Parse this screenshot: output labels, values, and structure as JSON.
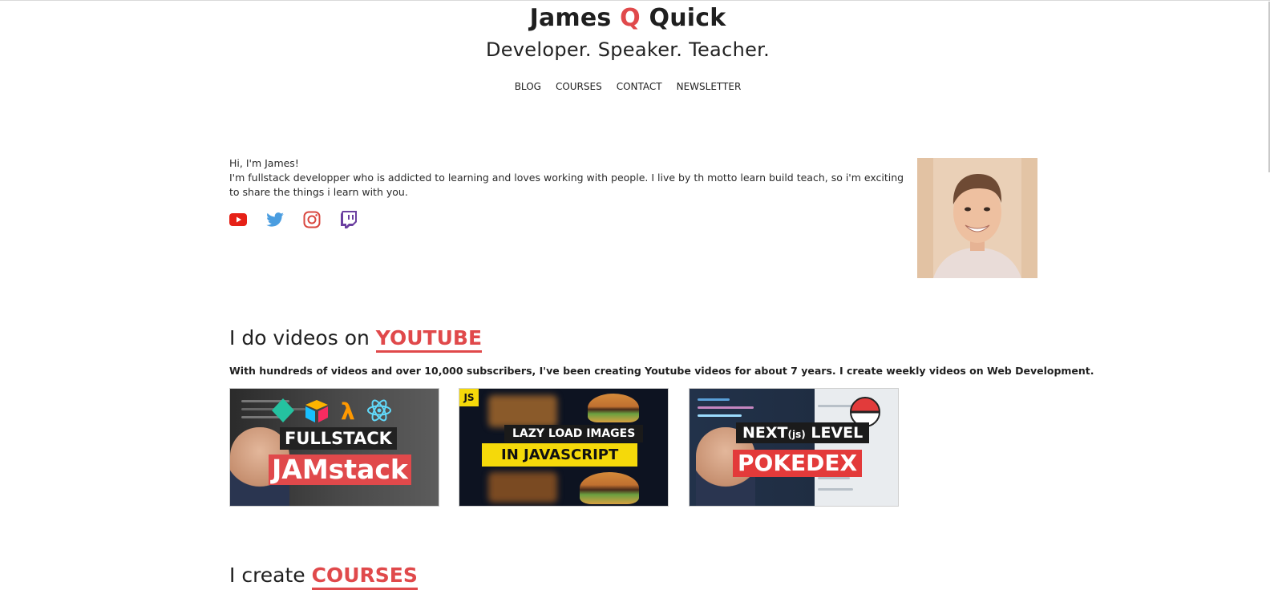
{
  "header": {
    "title_part1": "James",
    "title_accent": "Q",
    "title_part2": "Quick",
    "tagline": "Developer. Speaker. Teacher.",
    "nav": [
      "BLOG",
      "COURSES",
      "CONTACT",
      "NEWSLETTER"
    ]
  },
  "about": {
    "greeting": "Hi, I'm James!",
    "bio": "I'm fullstack developper who is addicted to learning and loves working with people. I live by th motto learn build teach, so i'm exciting to share the things i learn with you.",
    "socials": [
      "youtube-icon",
      "twitter-icon",
      "instagram-icon",
      "twitch-icon"
    ]
  },
  "youtube": {
    "heading_prefix": "I do videos on",
    "heading_highlight": "YOUTUBE",
    "description": "With hundreds of videos and over 10,000 subscribers, I've been creating Youtube videos for about 7 years. I create weekly videos on Web Development.",
    "thumbnails": [
      {
        "line1": "FULLSTACK",
        "line2": "JAMstack"
      },
      {
        "badge": "JS",
        "line1": "LAZY LOAD IMAGES",
        "line2": "IN JAVASCRIPT"
      },
      {
        "line1_a": "NEXT",
        "line1_b": "(js)",
        "line1_c": " LEVEL",
        "line2": "POKEDEX"
      }
    ]
  },
  "courses": {
    "heading_prefix": "I create",
    "heading_highlight": "COURSES"
  },
  "colors": {
    "accent": "#e0494b",
    "youtube": "#e62117",
    "twitter": "#4a9de0",
    "instagram": "#d9473f",
    "twitch": "#6b3fa0"
  }
}
